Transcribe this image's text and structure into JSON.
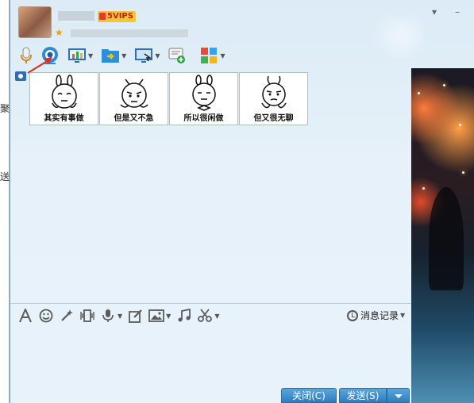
{
  "background_window": {
    "chars": [
      "聚",
      "送"
    ]
  },
  "header": {
    "vip_badge": "5VIPS",
    "minimize_glyph": "▾",
    "close_glyph": "–"
  },
  "toolbar": {
    "icons": [
      "microphone-icon",
      "video-camera-icon",
      "screen-share-icon",
      "file-transfer-icon",
      "remote-desktop-icon",
      "new-message-icon",
      "apps-icon"
    ]
  },
  "stickers": [
    {
      "caption": "其实有事做"
    },
    {
      "caption": "但是又不急"
    },
    {
      "caption": "所以很闲做"
    },
    {
      "caption": "但又很无聊"
    }
  ],
  "edit_toolbar": {
    "icons": [
      "font-icon",
      "emoji-icon",
      "magic-icon",
      "shake-icon",
      "voice-icon",
      "edit-icon",
      "image-icon",
      "music-icon",
      "screenshot-icon"
    ]
  },
  "history": {
    "label": "消息记录"
  },
  "buttons": {
    "close": "关闭(C)",
    "send": "发送(S)"
  },
  "colors": {
    "window_bg": "#e4eff8",
    "button_blue": "#3b8acb",
    "vip_gold": "#f6c43a",
    "arrow_red": "#e02b20"
  }
}
